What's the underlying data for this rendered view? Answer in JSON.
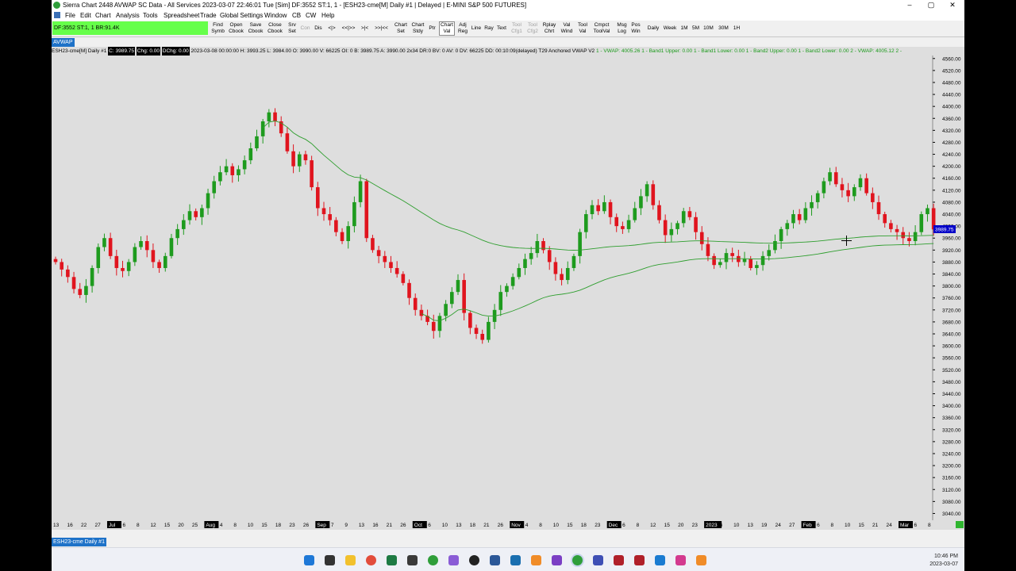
{
  "window": {
    "title": "Sierra Chart 2448 AVWAP  SC Data - All Services 2023-03-07  22:46:01 Tue [Sim]  DF:3552  ST:1, 1 - [ESH23-cme[M]  Daily  #1 | Delayed | E-MINI S&P 500 FUTURES]",
    "minimize": "–",
    "maximize": "▢",
    "close": "✕"
  },
  "menu": [
    "File",
    "Edit",
    "Chart",
    "Analysis",
    "Tools",
    "Spreadsheet",
    "Trade",
    "Global Settings",
    "Window",
    "CB",
    "CW",
    "Help"
  ],
  "toolbar": {
    "status_text": "DF:3552  ST:1, 1  BR:91.4K",
    "buttons": [
      {
        "label": "Find\nSymb",
        "state": "normal"
      },
      {
        "label": "Open\nCbook",
        "state": "normal"
      },
      {
        "label": "Save\nCbook",
        "state": "normal"
      },
      {
        "label": "Close\nCbook",
        "state": "normal"
      },
      {
        "label": "Srv\nSet",
        "state": "normal"
      },
      {
        "label": "Con",
        "state": "disabled"
      },
      {
        "label": "Dis",
        "state": "normal"
      },
      {
        "label": "<|>",
        "state": "normal"
      },
      {
        "label": "<<|>>",
        "state": "normal"
      },
      {
        "label": ">|<",
        "state": "normal"
      },
      {
        "label": ">>|<<",
        "state": "normal"
      },
      {
        "label": "Chart\nSet",
        "state": "normal"
      },
      {
        "label": "Chart\nStdy",
        "state": "normal"
      },
      {
        "label": "Ptr",
        "state": "normal"
      },
      {
        "label": "Chart\nVal",
        "state": "selected"
      },
      {
        "label": "Adj\nReg",
        "state": "normal"
      },
      {
        "label": "Line",
        "state": "normal"
      },
      {
        "label": "Ray",
        "state": "normal"
      },
      {
        "label": "Text",
        "state": "normal"
      },
      {
        "label": "Tool\nCfg1",
        "state": "disabled"
      },
      {
        "label": "Tool\nCfg2",
        "state": "disabled"
      },
      {
        "label": "Rplay\nChrt",
        "state": "normal"
      },
      {
        "label": "Val\nWind",
        "state": "normal"
      },
      {
        "label": "Tool\nVal",
        "state": "normal"
      },
      {
        "label": "Cmpct\nToolVal",
        "state": "normal"
      },
      {
        "label": "Msg\nLog",
        "state": "normal"
      },
      {
        "label": "Pos\nWin",
        "state": "normal"
      },
      {
        "label": "Daily",
        "state": "normal"
      },
      {
        "label": "Week",
        "state": "normal"
      },
      {
        "label": "1M",
        "state": "normal"
      },
      {
        "label": "5M",
        "state": "normal"
      },
      {
        "label": "10M",
        "state": "normal"
      },
      {
        "label": "30M",
        "state": "normal"
      },
      {
        "label": "1H",
        "state": "normal"
      }
    ]
  },
  "chart_tab": "AVWAP",
  "bottom_tab": "ESH23-cme  Daily  #1",
  "info": {
    "symbol": "ESH23-cme[M]  Daily  #1",
    "c": "C: 3989.75",
    "chg": "Chg: 0.00",
    "dchg": "DChg: 0.00",
    "details": "2023-03-08 00:00:00 H: 3993.25 L: 3984.00 O: 3990.00 V: 66225 OI: 0 B: 3989.75 A: 3990.00 2x34 DR:0 BV: 0 AV: 0 DV: 66225 DD: 00:10:09(delayed) T29 Anchored VWAP V2",
    "vwap": "1 - VWAP: 4005.26  1 - Band1 Upper: 0.00  1 - Band1 Lower: 0.00  1 - Band2 Upper: 0.00  1 - Band2 Lower: 0.00  2 - VWAP: 4005.12  2 -"
  },
  "colors": {
    "up": "#1e9b1e",
    "down": "#e0141e",
    "vwap": "#2e9e2e",
    "bg": "#dedede",
    "price_marker": "#0000c8"
  },
  "chart_data": {
    "type": "candlestick",
    "symbol": "ESH23-cme[M]",
    "timeframe": "Daily",
    "ylim": [
      3020,
      4570
    ],
    "y_ticks": [
      4560,
      4520,
      4480,
      4440,
      4400,
      4360,
      4320,
      4280,
      4240,
      4200,
      4160,
      4120,
      4080,
      4040,
      4000,
      3960,
      3920,
      3880,
      3840,
      3800,
      3760,
      3720,
      3680,
      3640,
      3600,
      3560,
      3520,
      3480,
      3440,
      3400,
      3360,
      3320,
      3280,
      3240,
      3200,
      3160,
      3120,
      3080,
      3040
    ],
    "last_price": "3989.75",
    "x_labels": [
      "13",
      "16",
      "22",
      "27",
      "Jul",
      "6",
      "8",
      "12",
      "15",
      "20",
      "25",
      "Aug",
      "4",
      "8",
      "10",
      "15",
      "18",
      "23",
      "26",
      "Sep",
      "7",
      "9",
      "13",
      "16",
      "21",
      "26",
      "Oct",
      "6",
      "10",
      "13",
      "18",
      "21",
      "26",
      "Nov",
      "4",
      "8",
      "10",
      "15",
      "18",
      "23",
      "Dec",
      "6",
      "8",
      "12",
      "15",
      "20",
      "23",
      "2023",
      "6",
      "10",
      "13",
      "19",
      "24",
      "27",
      "Feb",
      "6",
      "8",
      "10",
      "15",
      "21",
      "24",
      "Mar",
      "6",
      "8"
    ],
    "x_month_labels": [
      "Jul",
      "Aug",
      "Sep",
      "Oct",
      "Nov",
      "Dec",
      "2023",
      "Feb",
      "Mar"
    ],
    "close": [
      3880,
      3855,
      3830,
      3790,
      3770,
      3800,
      3860,
      3930,
      3960,
      3900,
      3860,
      3850,
      3880,
      3930,
      3950,
      3920,
      3880,
      3860,
      3900,
      3960,
      3990,
      4020,
      4050,
      4030,
      4060,
      4110,
      4150,
      4180,
      4200,
      4170,
      4190,
      4220,
      4260,
      4300,
      4350,
      4380,
      4350,
      4310,
      4250,
      4200,
      4240,
      4220,
      4130,
      4060,
      4040,
      4020,
      3980,
      3950,
      4000,
      4080,
      4150,
      3960,
      3920,
      3900,
      3880,
      3860,
      3840,
      3810,
      3760,
      3720,
      3700,
      3680,
      3650,
      3700,
      3740,
      3780,
      3820,
      3710,
      3660,
      3640,
      3620,
      3680,
      3720,
      3780,
      3800,
      3830,
      3860,
      3890,
      3910,
      3950,
      3920,
      3880,
      3840,
      3820,
      3860,
      3900,
      3980,
      4040,
      4070,
      4050,
      4080,
      4030,
      4000,
      3990,
      4020,
      4060,
      4100,
      4140,
      4070,
      4020,
      3970,
      3990,
      4010,
      4050,
      4030,
      3980,
      3940,
      3900,
      3870,
      3880,
      3910,
      3900,
      3880,
      3890,
      3860,
      3870,
      3900,
      3920,
      3950,
      3990,
      4010,
      4040,
      4020,
      4060,
      4080,
      4110,
      4150,
      4180,
      4140,
      4120,
      4100,
      4130,
      4160,
      4110,
      4080,
      4040,
      4010,
      3990,
      3980,
      3960,
      3950,
      3980,
      4040,
      4060,
      3989
    ]
  }
}
